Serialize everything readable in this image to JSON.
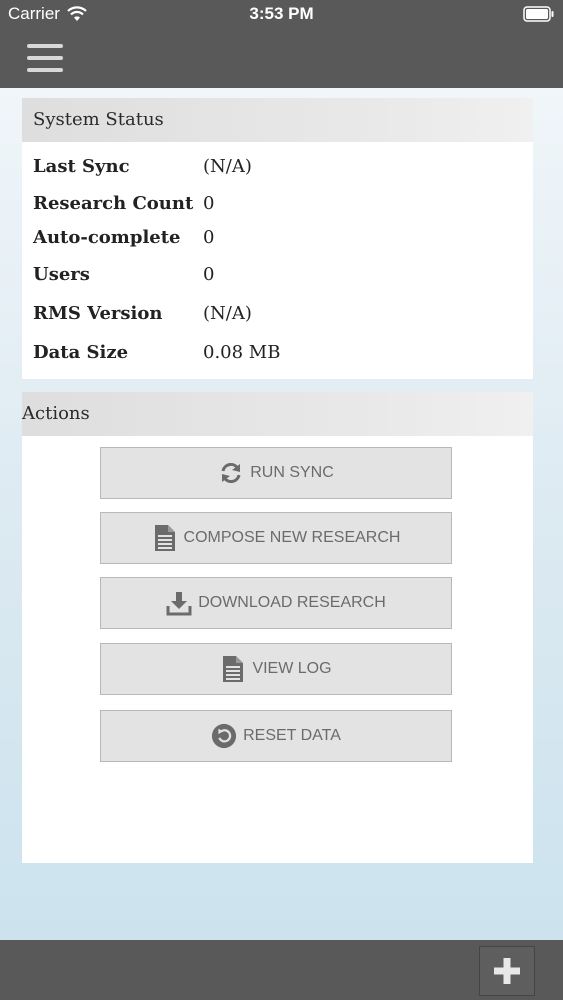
{
  "status_bar": {
    "carrier": "Carrier",
    "time": "3:53 PM"
  },
  "header": {
    "menu_icon": "hamburger-menu-icon"
  },
  "system_status": {
    "title": "System Status",
    "rows": [
      {
        "label": "Last Sync",
        "value": "(N/A)"
      },
      {
        "label": "Research Count",
        "value": "0"
      },
      {
        "label": "Auto-complete",
        "value": "0"
      },
      {
        "label": "Users",
        "value": "0"
      },
      {
        "label": "RMS Version",
        "value": "(N/A)"
      },
      {
        "label": "Data Size",
        "value": "0.08 MB"
      }
    ]
  },
  "actions": {
    "title": "Actions",
    "buttons": [
      {
        "label": "RUN SYNC",
        "icon": "sync-icon"
      },
      {
        "label": "COMPOSE NEW RESEARCH",
        "icon": "document-icon"
      },
      {
        "label": "DOWNLOAD RESEARCH",
        "icon": "download-icon"
      },
      {
        "label": "VIEW LOG",
        "icon": "document-icon"
      },
      {
        "label": "RESET DATA",
        "icon": "reset-icon"
      }
    ]
  },
  "footer": {
    "add_icon": "plus-icon"
  },
  "colors": {
    "bar": "#595959",
    "panel_header": "#e3e3e3",
    "button": "#e3e3e3",
    "button_text": "#6b6b6b"
  }
}
